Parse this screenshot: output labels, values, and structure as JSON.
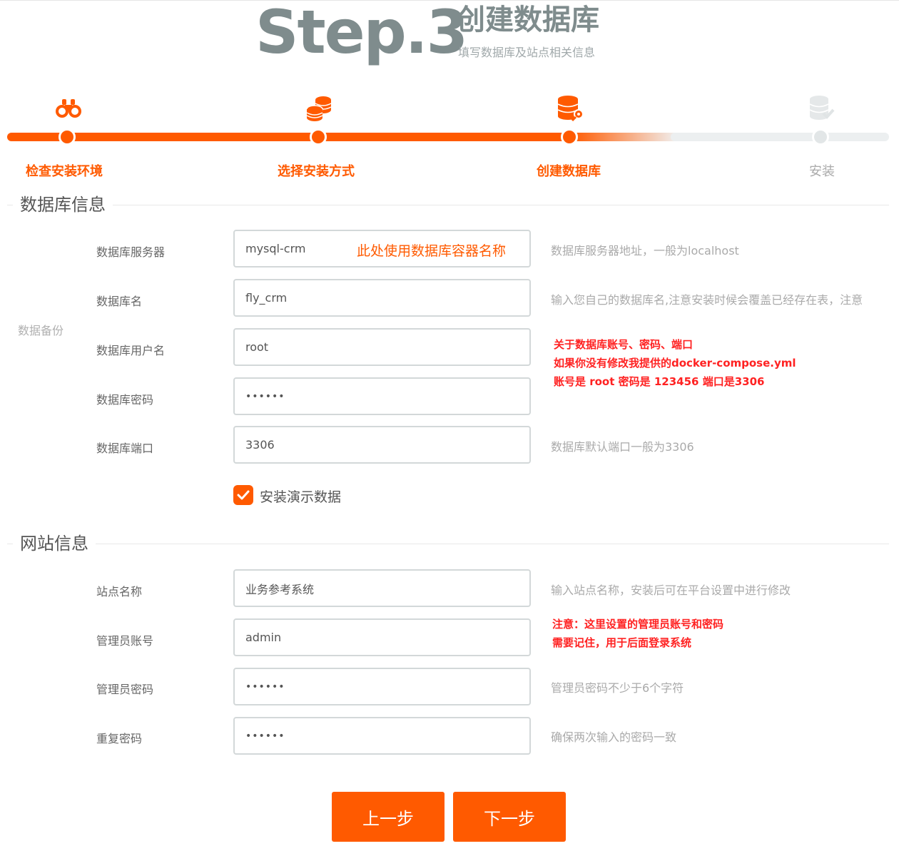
{
  "header": {
    "step_number": "Step.3",
    "title": "创建数据库",
    "subtitle": "填写数据库及站点相关信息"
  },
  "colors": {
    "accent": "#ff5a00",
    "muted": "#7f8c8d",
    "note_red": "#ff2222"
  },
  "steps": [
    {
      "label": "检查安装环境",
      "icon": "binoculars-icon",
      "state": "done"
    },
    {
      "label": "选择安装方式",
      "icon": "coins-stack-icon",
      "state": "done"
    },
    {
      "label": "创建数据库",
      "icon": "database-key-icon",
      "state": "current"
    },
    {
      "label": "安装",
      "icon": "database-check-icon",
      "state": "todo"
    }
  ],
  "db_section": {
    "title": "数据库信息",
    "side_label": "数据备份",
    "server": {
      "label": "数据库服务器",
      "value": "mysql-crm",
      "note": "此处使用数据库容器名称",
      "hint": "数据库服务器地址，一般为localhost"
    },
    "name": {
      "label": "数据库名",
      "value": "fly_crm",
      "hint": "输入您自己的数据库名,注意安装时候会覆盖已经存在表，注意"
    },
    "user": {
      "label": "数据库用户名",
      "value": "root"
    },
    "password": {
      "label": "数据库密码",
      "value": "••••••"
    },
    "port": {
      "label": "数据库端口",
      "value": "3306",
      "hint": "数据库默认端口一般为3306"
    },
    "red_note": [
      "关于数据库账号、密码、端口",
      "如果你没有修改我提供的docker-compose.yml",
      "账号是 root  密码是 123456 端口是3306"
    ],
    "demo_checkbox": {
      "label": "安装演示数据",
      "checked": true
    }
  },
  "site_section": {
    "title": "网站信息",
    "site_name": {
      "label": "站点名称",
      "value": "业务参考系统",
      "hint": "输入站点名称，安装后可在平台设置中进行修改"
    },
    "admin_account": {
      "label": "管理员账号",
      "value": "admin"
    },
    "admin_password": {
      "label": "管理员密码",
      "value": "••••••",
      "hint": "管理员密码不少于6个字符"
    },
    "repeat_password": {
      "label": "重复密码",
      "value": "••••••",
      "hint": "确保两次输入的密码一致"
    },
    "red_note": [
      "注意：这里设置的管理员账号和密码",
      "需要记住，用于后面登录系统"
    ]
  },
  "buttons": {
    "prev": "上一步",
    "next": "下一步"
  }
}
